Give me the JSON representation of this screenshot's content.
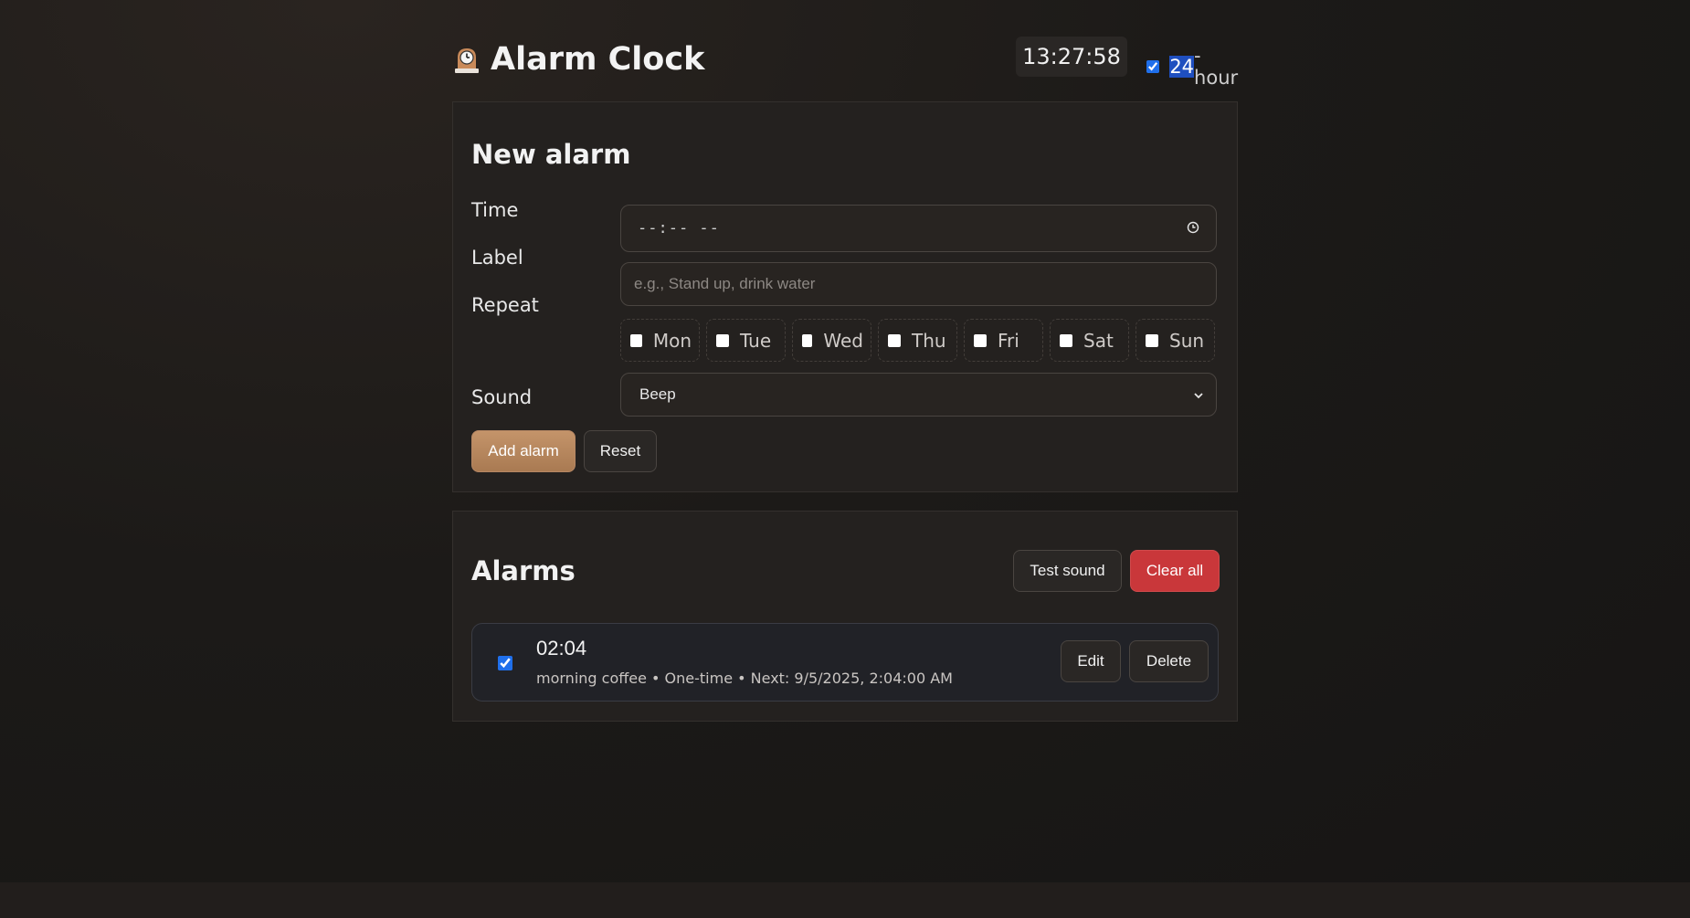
{
  "header": {
    "icon": "mantel-clock-icon",
    "title": "Alarm Clock",
    "current_time": "13:27:58",
    "hour_mode_checked": true,
    "hour_mode_highlight": "24",
    "hour_mode_rest": "-hour"
  },
  "new_alarm": {
    "heading": "New alarm",
    "time_label": "Time",
    "time_value": "--:-- --",
    "label_label": "Label",
    "label_placeholder": "e.g., Stand up, drink water",
    "repeat_label": "Repeat",
    "days": [
      "Mon",
      "Tue",
      "Wed",
      "Thu",
      "Fri",
      "Sat",
      "Sun"
    ],
    "sound_label": "Sound",
    "sound_value": "Beep",
    "add_button": "Add alarm",
    "reset_button": "Reset"
  },
  "alarms": {
    "heading": "Alarms",
    "test_button": "Test sound",
    "clear_button": "Clear all",
    "items": [
      {
        "enabled": true,
        "time": "02:04",
        "meta": "morning coffee • One-time • Next: 9/5/2025, 2:04:00 AM",
        "edit": "Edit",
        "delete": "Delete"
      }
    ]
  },
  "colors": {
    "accent": "#1f6feb",
    "add_button": "#b98a60",
    "danger": "#c9373a"
  }
}
